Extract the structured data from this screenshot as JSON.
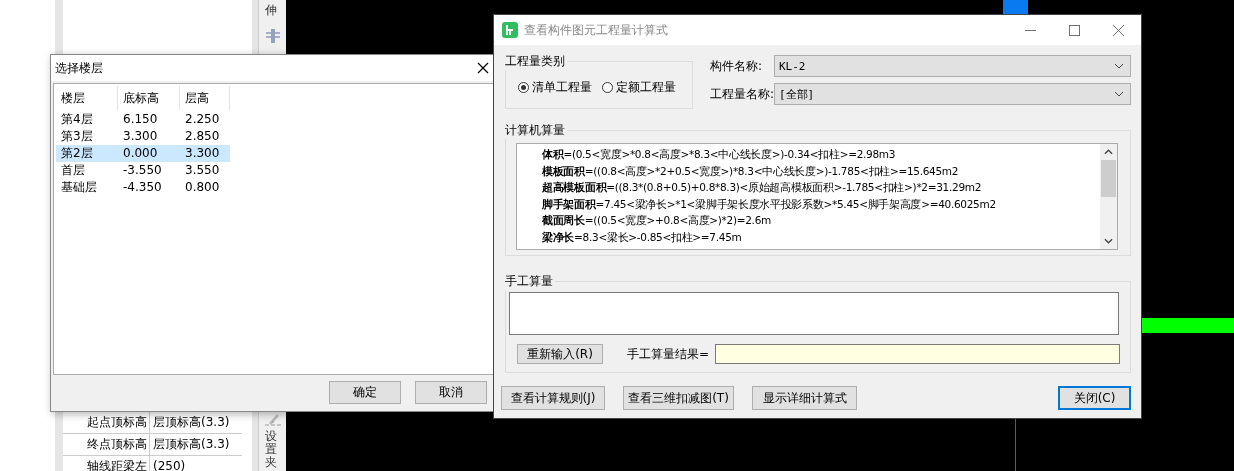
{
  "background": {
    "toolbar_labels": [
      "伸",
      "设置夹"
    ],
    "properties": [
      {
        "name": "起点顶标高",
        "value": "层顶标高(3.3)"
      },
      {
        "name": "终点顶标高",
        "value": "层顶标高(3.3)"
      },
      {
        "name": "轴线距梁左",
        "value": "(250)"
      }
    ]
  },
  "floor_dialog": {
    "title": "选择楼层",
    "columns": [
      "楼层",
      "底标高",
      "层高"
    ],
    "rows": [
      {
        "cells": [
          "第4层",
          "6.150",
          "2.250"
        ],
        "selected": false
      },
      {
        "cells": [
          "第3层",
          "3.300",
          "2.850"
        ],
        "selected": false
      },
      {
        "cells": [
          "第2层",
          "0.000",
          "3.300"
        ],
        "selected": true
      },
      {
        "cells": [
          "首层",
          "-3.550",
          "3.550"
        ],
        "selected": false
      },
      {
        "cells": [
          "基础层",
          "-4.350",
          "0.800"
        ],
        "selected": false
      }
    ],
    "buttons": [
      "确定",
      "取消"
    ]
  },
  "quantity_dialog": {
    "title": "查看构件图元工程量计算式",
    "category": {
      "label": "工程量类别",
      "options": [
        {
          "label": "清单工程量",
          "selected": true
        },
        {
          "label": "定额工程量",
          "selected": false
        }
      ]
    },
    "component_name": {
      "label": "构件名称:",
      "value": "KL-2"
    },
    "quantity_name": {
      "label": "工程量名称:",
      "value": "[全部]"
    },
    "computer": {
      "label": "计算机算量",
      "lines": [
        "**体积**=(0.5<宽度>*0.8<高度>*8.3<中心线长度>)-0.34<扣柱>=2.98m3",
        "**模板面积**=((0.8<高度>*2+0.5<宽度>)*8.3<中心线长度>)-1.785<扣柱>=15.645m2",
        "**超高模板面积**=((8.3*(0.8+0.5)+0.8*8.3)<原始超高模板面积>-1.785<扣柱>)*2=31.29m2",
        "**脚手架面积**=7.45<梁净长>*1<梁脚手架长度水平投影系数>*5.45<脚手架高度>=40.6025m2",
        "**截面周长**=((0.5<宽度>+0.8<高度>)*2)=2.6m",
        "**梁净长**=8.3<梁长>-0.85<扣柱>=7.45m"
      ]
    },
    "manual": {
      "label": "手工算量",
      "reinput_button": "重新输入(R)",
      "result_label": "手工算量结果="
    },
    "buttons": [
      {
        "label": "查看计算规则(J)",
        "default": false
      },
      {
        "label": "查看三维扣减图(T)",
        "default": false
      },
      {
        "label": "显示详细计算式",
        "default": false
      },
      {
        "label": "关闭(C)",
        "default": true
      }
    ]
  }
}
